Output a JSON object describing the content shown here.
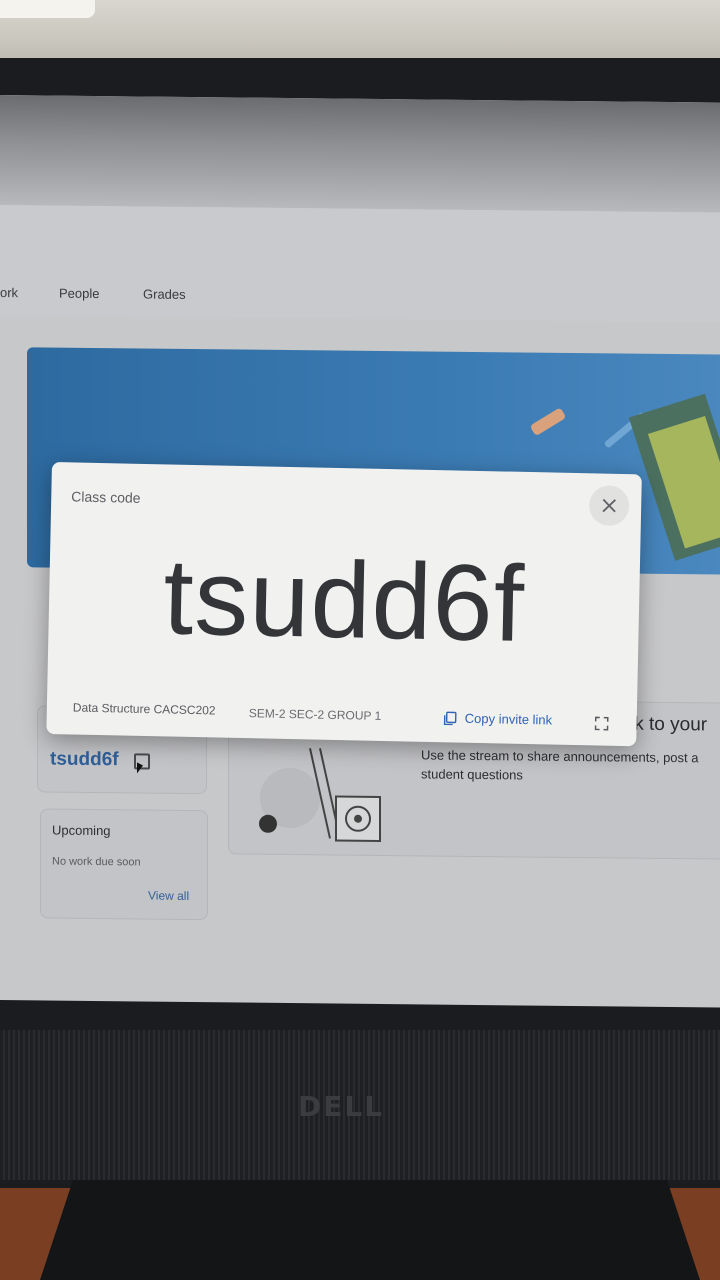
{
  "nav": {
    "tab_partial": "ork",
    "tab_people": "People",
    "tab_grades": "Grades"
  },
  "modal": {
    "title": "Class code",
    "code": "tsudd6f",
    "class_name": "Data Structure CACSC202",
    "section": "SEM-2 SEC-2 GROUP 1",
    "copy_link_label": "Copy invite link"
  },
  "sidebar": {
    "class_code_small": "tsudd6f",
    "upcoming_title": "Upcoming",
    "upcoming_empty": "No work due soon",
    "view_all": "View all"
  },
  "stream": {
    "heading_partial": "lk to your",
    "description": "Use the stream to share announcements, post a student questions"
  },
  "monitor": {
    "brand": "DELL"
  },
  "colors": {
    "accent_blue": "#2f64b5",
    "banner_blue": "#3b7bb3"
  }
}
